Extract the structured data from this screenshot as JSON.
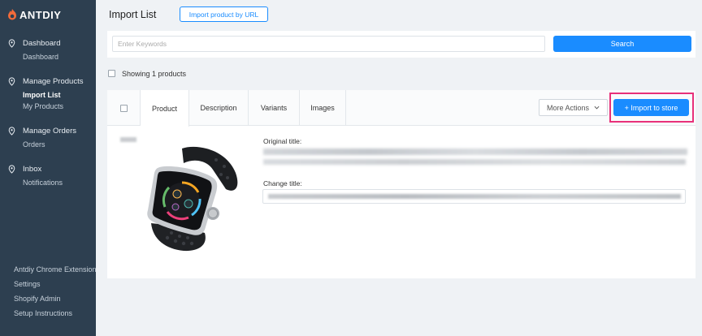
{
  "brand": {
    "name": "ANTDIY"
  },
  "sidebar": {
    "groups": [
      {
        "title": "Dashboard",
        "icon": "location-pin-icon",
        "items": [
          "Dashboard"
        ]
      },
      {
        "title": "Manage Products",
        "icon": "location-pin-icon",
        "items": [
          "Import List",
          "My Products"
        ]
      },
      {
        "title": "Manage Orders",
        "icon": "location-pin-icon",
        "items": [
          "Orders"
        ]
      },
      {
        "title": "Inbox",
        "icon": "location-pin-icon",
        "items": [
          "Notifications"
        ]
      }
    ],
    "footer": [
      "Antdiy Chrome Extension",
      "Settings",
      "Shopify Admin",
      "Setup Instructions"
    ]
  },
  "header": {
    "title": "Import List",
    "import_url_label": "Import product by URL"
  },
  "search": {
    "placeholder": "Enter Keywords",
    "button_label": "Search"
  },
  "list": {
    "showing_text": "Showing 1 products"
  },
  "product_card": {
    "tabs": [
      "Product",
      "Description",
      "Variants",
      "Images"
    ],
    "active_tab": "Product",
    "more_actions_label": "More Actions",
    "import_button_label": "+ Import to store",
    "original_title_label": "Original title:",
    "change_title_label": "Change title:"
  },
  "colors": {
    "sidebar_bg": "#2d3f50",
    "accent": "#1a8cff",
    "highlight": "#e8317a",
    "page_bg": "#eff2f5"
  }
}
